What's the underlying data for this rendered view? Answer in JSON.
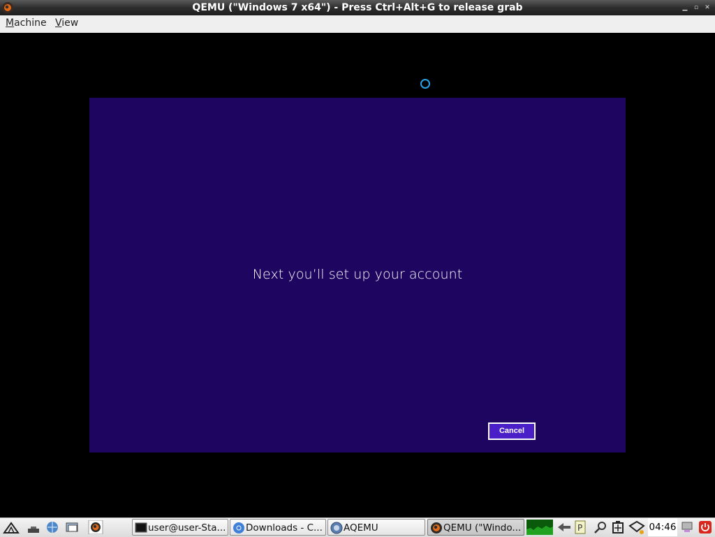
{
  "window": {
    "title": "QEMU (\"Windows 7 x64\") - Press Ctrl+Alt+G to release grab",
    "controls": [
      "minimize-icon",
      "restore-icon",
      "close-icon"
    ]
  },
  "menubar": {
    "items": [
      {
        "label": "Machine",
        "mnemonic": "M"
      },
      {
        "label": "View",
        "mnemonic": "V"
      }
    ]
  },
  "guest": {
    "message": "Next you’ll set up your account",
    "cancel_label": "Cancel",
    "colors": {
      "background": "#1d0560",
      "button": "#4a1fc7",
      "spinner": "#2aa5e6"
    }
  },
  "taskbar": {
    "launchers": [
      "menu-icon",
      "show-desktop-icon",
      "browser-icon",
      "file-manager-icon",
      "qemu-icon"
    ],
    "tasks": [
      {
        "label": "user@user-Sta...",
        "icon": "terminal-icon"
      },
      {
        "label": "Downloads - C...",
        "icon": "chromium-icon"
      },
      {
        "label": "AQEMU",
        "icon": "aqemu-icon"
      },
      {
        "label": "QEMU (\"Windo...",
        "icon": "qemu-icon",
        "active": true
      }
    ],
    "clock": "04:46"
  }
}
